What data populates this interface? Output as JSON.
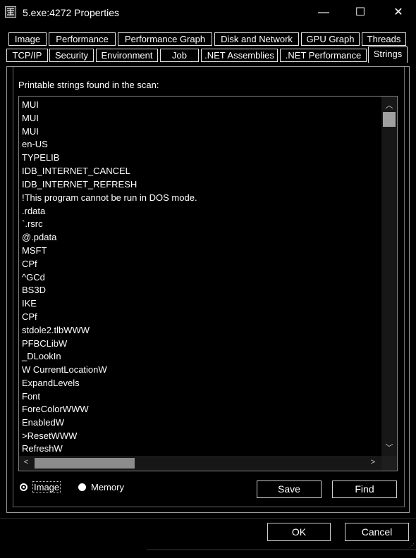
{
  "window": {
    "title": "5.exe:4272 Properties",
    "controls": {
      "minimize": "—",
      "maximize": "☐",
      "close": "✕"
    }
  },
  "tabs": {
    "row1": [
      "Image",
      "Performance",
      "Performance Graph",
      "Disk and Network",
      "GPU Graph",
      "Threads"
    ],
    "row2": [
      "TCP/IP",
      "Security",
      "Environment",
      "Job",
      ".NET Assemblies",
      ".NET Performance",
      "Strings"
    ],
    "active": "Strings"
  },
  "strings_panel": {
    "label": "Printable strings found in the scan:",
    "items": [
      "MUI",
      "MUI",
      "MUI",
      "en-US",
      "TYPELIB",
      "IDB_INTERNET_CANCEL",
      "IDB_INTERNET_REFRESH",
      "!This program cannot be run in DOS mode.",
      ".rdata",
      "`.rsrc",
      "@.pdata",
      "MSFT",
      "CPf",
      "^GCd",
      "BS3D",
      "IKE",
      "CPf",
      "stdole2.tlbWWW",
      "PFBCLibW",
      "_DLookIn",
      "W CurrentLocationW",
      "ExpandLevels",
      "Font",
      "ForeColorWWW",
      "EnabledW",
      ">ResetWWW",
      "RefreshW"
    ],
    "scope": {
      "options": [
        "Image",
        "Memory"
      ],
      "selected": "Image"
    },
    "save_label": "Save",
    "find_label": "Find"
  },
  "footer": {
    "ok_label": "OK",
    "cancel_label": "Cancel"
  },
  "colors": {
    "background": "#000000",
    "text": "#ffffff",
    "border": "#9a9a9a"
  }
}
